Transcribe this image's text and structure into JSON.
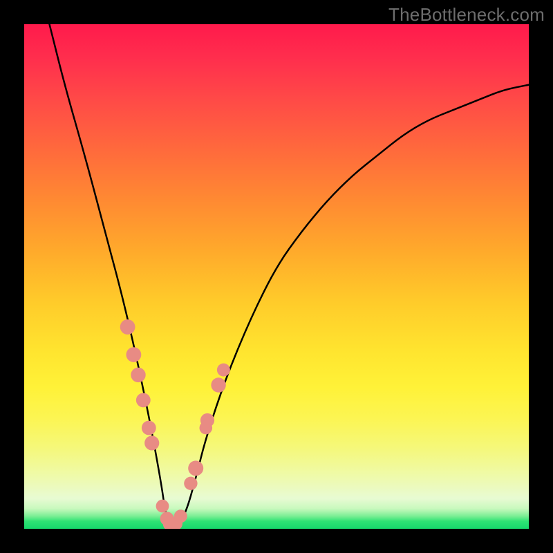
{
  "watermark": "TheBottleneck.com",
  "colors": {
    "frame": "#000000",
    "curve": "#000000",
    "dot": "#e88b84"
  },
  "chart_data": {
    "type": "line",
    "title": "",
    "xlabel": "",
    "ylabel": "",
    "xlim": [
      0,
      100
    ],
    "ylim": [
      0,
      100
    ],
    "grid": false,
    "legend": false,
    "note": "V-shaped bottleneck deviation curve. x ≈ component index (normalized 0–100), y ≈ deviation/bottleneck % (0 = best match at valley). Valley at x≈29, y≈0. Values read from curve geometry (no numeric axes shown).",
    "series": [
      {
        "name": "bottleneck-curve",
        "x": [
          5,
          8,
          12,
          16,
          20,
          24,
          27,
          28,
          29,
          30,
          32,
          34,
          36,
          40,
          45,
          50,
          55,
          60,
          65,
          70,
          75,
          80,
          85,
          90,
          95,
          100
        ],
        "y": [
          100,
          88,
          74,
          59,
          44,
          26,
          10,
          3,
          0,
          0,
          3,
          10,
          18,
          30,
          42,
          52,
          59,
          65,
          70,
          74,
          78,
          81,
          83,
          85,
          87,
          88
        ]
      }
    ],
    "highlighted_points": {
      "name": "marked-components",
      "note": "Pink dots along curve near valley — individual hardware items clustered around the optimum.",
      "x": [
        20.5,
        21.7,
        22.6,
        23.6,
        24.7,
        25.3,
        27.4,
        28.3,
        29.0,
        30.1,
        31.0,
        33.0,
        34.0,
        36.0,
        36.3,
        38.5,
        39.5
      ],
      "y": [
        40.0,
        34.5,
        30.5,
        25.5,
        20.0,
        17.0,
        4.5,
        2.0,
        1.0,
        1.0,
        2.5,
        9.0,
        12.0,
        20.0,
        21.5,
        28.5,
        31.5
      ]
    }
  }
}
